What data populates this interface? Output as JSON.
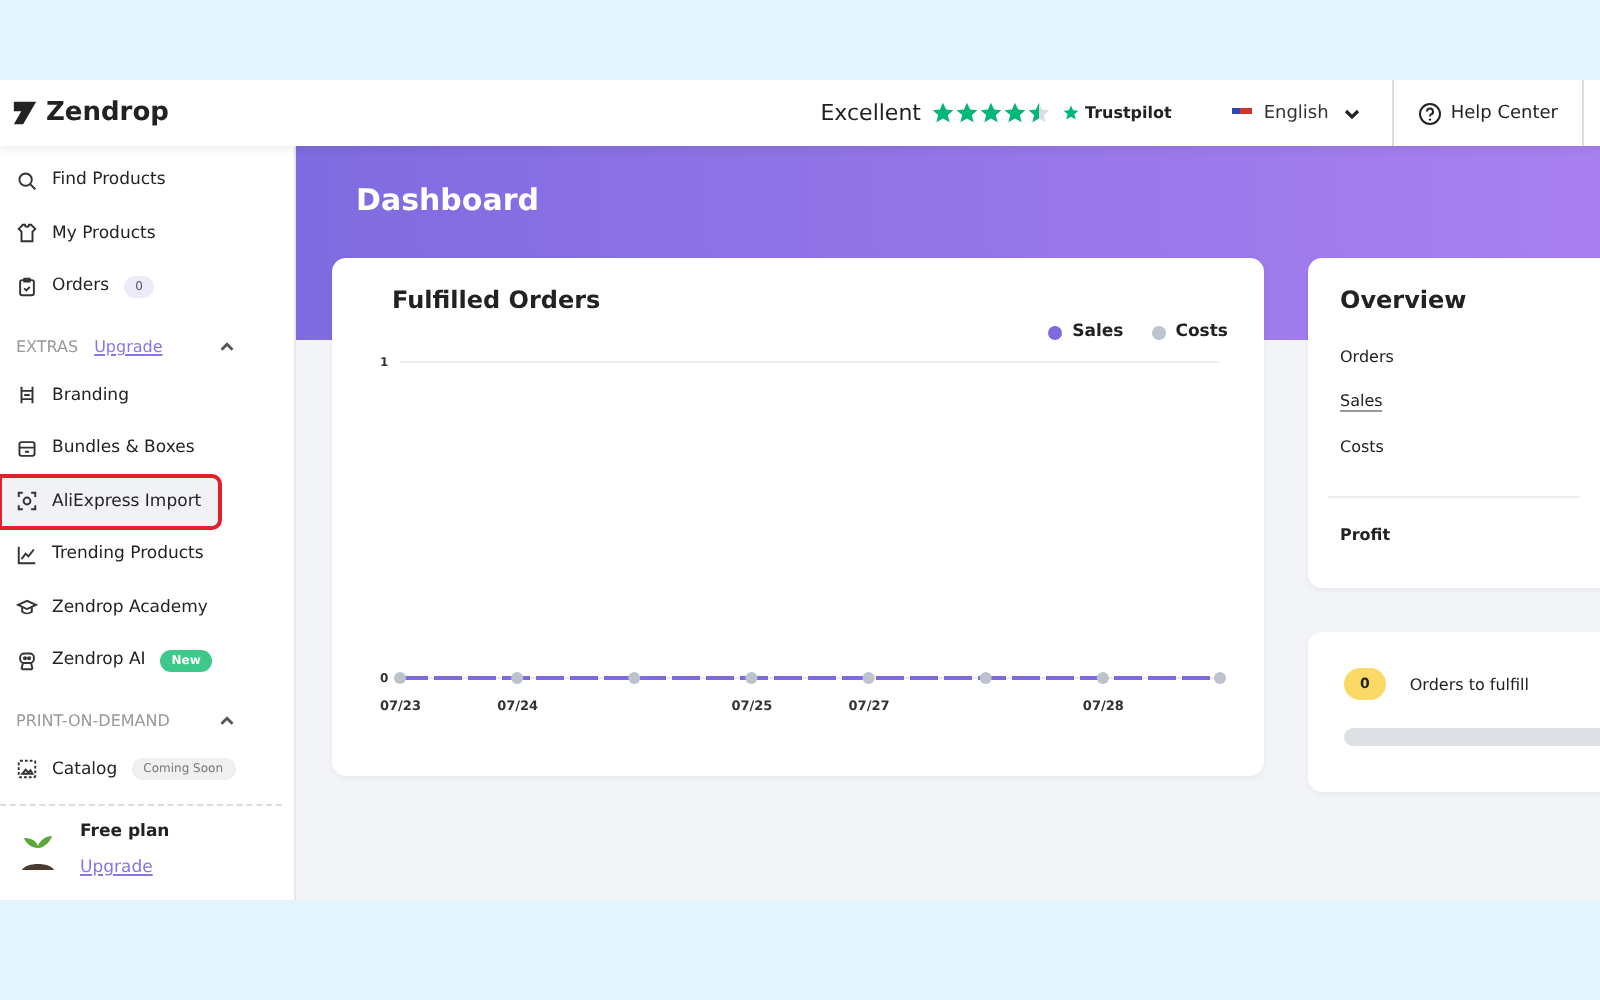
{
  "topbar": {
    "logo": "Zendrop",
    "rating_label": "Excellent",
    "stars": 4.5,
    "trustpilot": "Trustpilot",
    "language": "English",
    "help": "Help Center"
  },
  "sidebar": {
    "items": [
      {
        "label": "Find Products",
        "selected": false,
        "highlighted": false
      },
      {
        "label": "My Products",
        "selected": false,
        "highlighted": false
      },
      {
        "label": "Orders",
        "badge": "0",
        "kind": "count",
        "selected": false,
        "highlighted": false
      }
    ],
    "sections": [
      {
        "title": "EXTRAS",
        "link": "Upgrade",
        "expanded": true,
        "items": [
          {
            "label": "Branding",
            "selected": false,
            "highlighted": false
          },
          {
            "label": "Bundles & Boxes",
            "selected": false,
            "highlighted": false
          },
          {
            "label": "AliExpress Import",
            "selected": true,
            "highlighted": true
          },
          {
            "label": "Trending Products",
            "selected": false,
            "highlighted": false
          },
          {
            "label": "Zendrop Academy",
            "selected": false,
            "highlighted": false
          },
          {
            "label": "Zendrop AI",
            "badge": "New",
            "kind": "new",
            "selected": false,
            "highlighted": false
          }
        ]
      },
      {
        "title": "PRINT-ON-DEMAND",
        "expanded": true,
        "items": [
          {
            "label": "Catalog",
            "badge": "Coming Soon",
            "kind": "soon",
            "selected": false,
            "highlighted": false
          }
        ]
      }
    ],
    "plan": {
      "name": "Free plan",
      "link": "Upgrade"
    }
  },
  "header": {
    "title": "Dashboard"
  },
  "fulfilled": {
    "title": "Fulfilled Orders",
    "chart_data": {
      "type": "line",
      "categories": [
        "07/23",
        "07/24",
        null,
        "07/25",
        "07/27",
        null,
        "07/28",
        null
      ],
      "ylim": [
        0,
        1
      ],
      "yticks": [
        0,
        1
      ],
      "series": [
        {
          "name": "Sales",
          "color": "#7f6be0",
          "line_style": "dashed",
          "marker": true,
          "values": [
            0,
            0,
            0,
            0,
            0,
            0,
            0,
            0
          ]
        },
        {
          "name": "Costs",
          "color": "#bcc3cc",
          "values": [
            null,
            null,
            null,
            null,
            null,
            null,
            null,
            null
          ]
        }
      ]
    }
  },
  "overview": {
    "title": "Overview",
    "rows": [
      {
        "label": "Orders",
        "underlined": false
      },
      {
        "label": "Sales",
        "underlined": true
      },
      {
        "label": "Costs",
        "underlined": false
      }
    ],
    "total": "Profit"
  },
  "fulfill": {
    "count": "0",
    "label": "Orders to fulfill",
    "level": 0
  }
}
